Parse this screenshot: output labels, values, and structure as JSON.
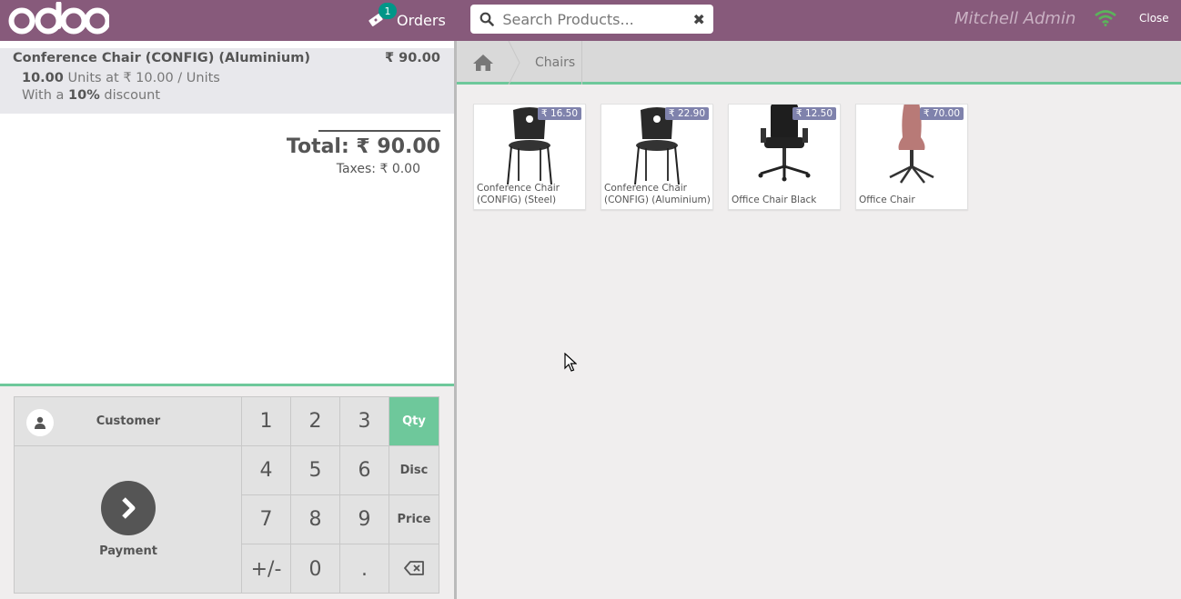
{
  "header": {
    "logo_text": "odoo",
    "orders_label": "Orders",
    "orders_count": "1",
    "search_placeholder": "Search Products...",
    "user_name": "Mitchell Admin",
    "close_label": "Close",
    "icons": [
      "ticket-icon",
      "search-icon",
      "clear-icon",
      "wifi-icon"
    ]
  },
  "order": {
    "lines": [
      {
        "name": "Conference Chair (CONFIG) (Aluminium)",
        "price": "₹ 90.00",
        "qty": "10.00",
        "unit_text": "Units at ₹ 10.00 / Units",
        "discount_prefix": "With a",
        "discount_value": "10%",
        "discount_suffix": "discount"
      }
    ],
    "total": "Total: ₹ 90.00",
    "taxes": "Taxes: ₹ 0.00"
  },
  "pad": {
    "customer_label": "Customer",
    "payment_label": "Payment",
    "keys": [
      "1",
      "2",
      "3",
      "4",
      "5",
      "6",
      "7",
      "8",
      "9",
      "+/-",
      "0",
      "."
    ],
    "modes": [
      "Qty",
      "Disc",
      "Price"
    ],
    "active_mode": "Qty"
  },
  "breadcrumb": {
    "category": "Chairs"
  },
  "products": [
    {
      "name": "Conference Chair (CONFIG) (Steel)",
      "price": "₹ 16.50"
    },
    {
      "name": "Conference Chair (CONFIG) (Aluminium)",
      "price": "₹ 22.90"
    },
    {
      "name": "Office Chair Black",
      "price": "₹ 12.50"
    },
    {
      "name": "Office Chair",
      "price": "₹ 70.00"
    }
  ],
  "colors": {
    "header": "#875a7b",
    "accent": "#6ec89b",
    "price_tag": "#7f82ac",
    "badge": "#009688"
  }
}
